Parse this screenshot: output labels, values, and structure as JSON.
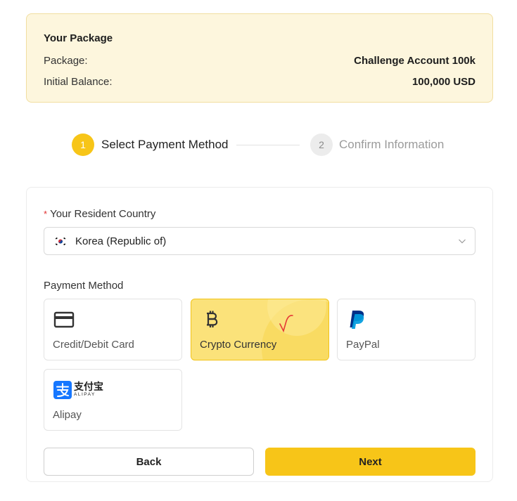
{
  "package_box": {
    "title": "Your Package",
    "rows": [
      {
        "label": "Package:",
        "value": "Challenge Account 100k"
      },
      {
        "label": "Initial Balance:",
        "value": "100,000 USD"
      }
    ]
  },
  "steps": [
    {
      "number": "1",
      "label": "Select Payment Method",
      "state": "active"
    },
    {
      "number": "2",
      "label": "Confirm Information",
      "state": "inactive"
    }
  ],
  "form": {
    "country_label": "Your Resident Country",
    "required_mark": "*",
    "country_value": "Korea (Republic of)",
    "country_flag_icon": "south-korea-flag-icon",
    "payment_label": "Payment Method",
    "methods": [
      {
        "label": "Credit/Debit Card",
        "icon": "credit-card-icon",
        "selected": false
      },
      {
        "label": "Crypto Currency",
        "icon": "bitcoin-icon",
        "selected": true
      },
      {
        "label": "PayPal",
        "icon": "paypal-icon",
        "selected": false
      },
      {
        "label": "Alipay",
        "icon": "alipay-icon",
        "logo_text": "支付宝",
        "logo_subtext": "ALIPAY",
        "selected": false
      }
    ]
  },
  "buttons": {
    "back": "Back",
    "next": "Next"
  },
  "colors": {
    "accent": "#f7c518",
    "selected_bg": "#fbe27a",
    "package_bg": "#fdf6dd",
    "required": "#e03131",
    "paypal_dark": "#003087",
    "paypal_light": "#009cde",
    "alipay": "#1677ff"
  }
}
